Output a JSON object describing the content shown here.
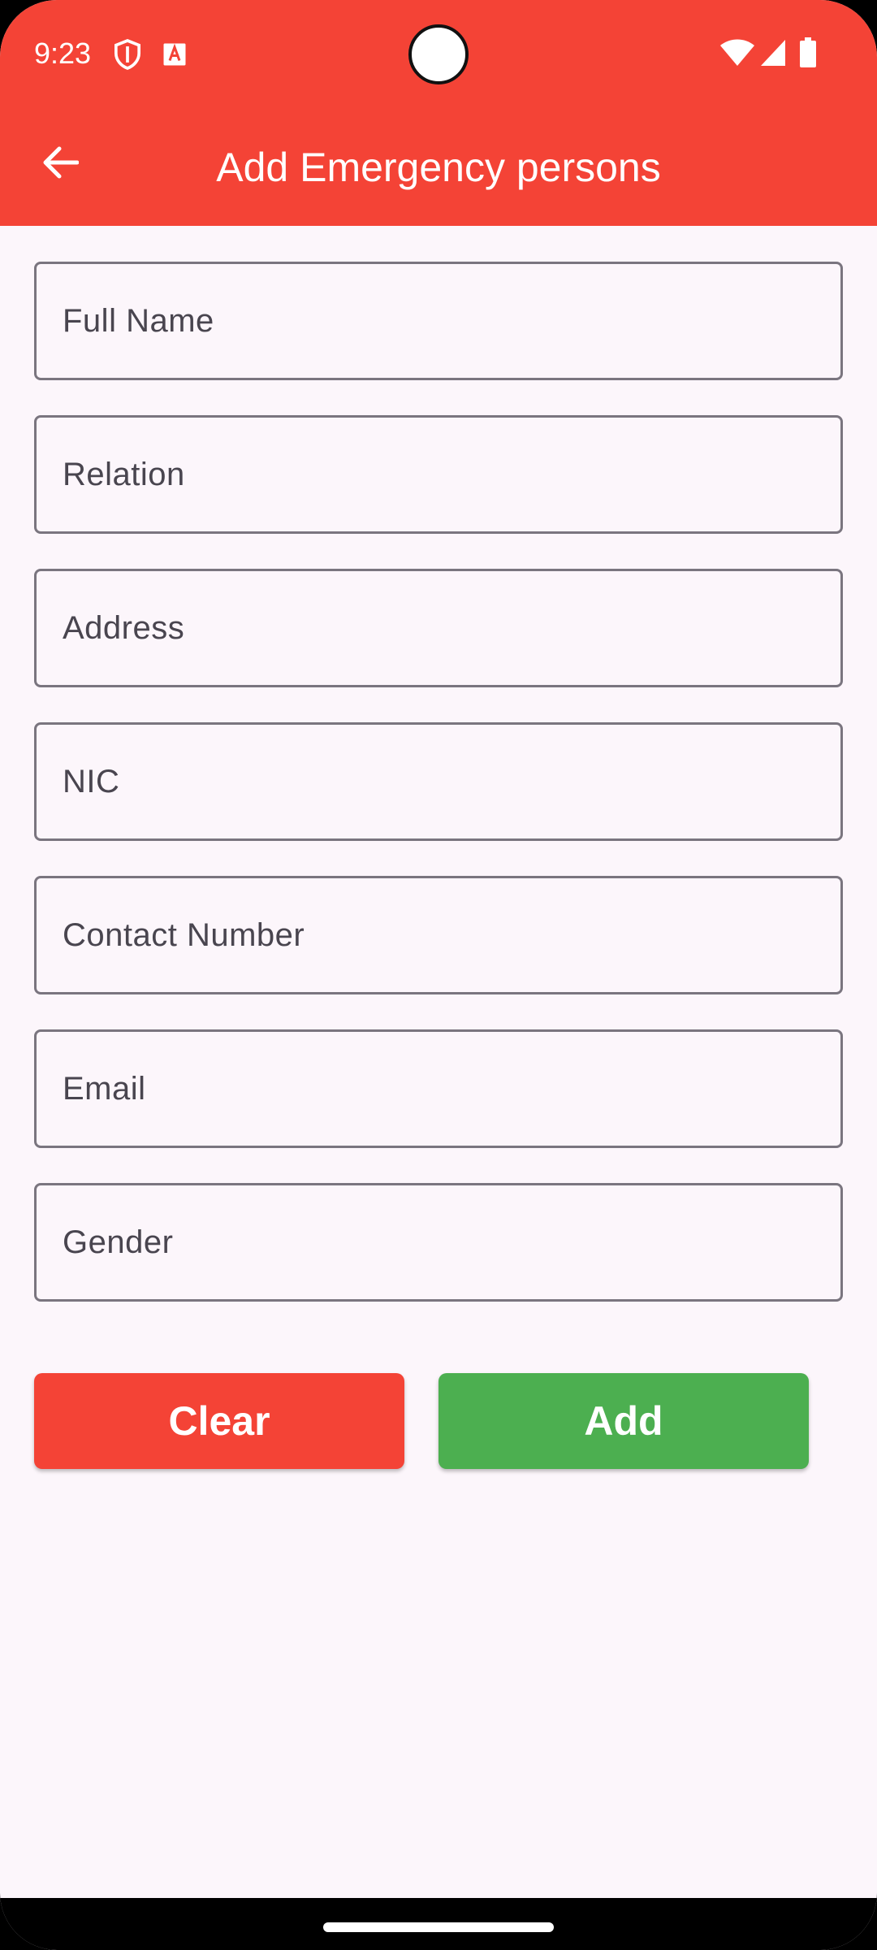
{
  "status_bar": {
    "time": "9:23",
    "left_icons": [
      "shield-icon",
      "font-icon"
    ],
    "right_icons": [
      "wifi-icon",
      "cellular-signal-icon",
      "battery-icon"
    ]
  },
  "app_bar": {
    "title": "Add Emergency persons",
    "back_icon": "arrow-back-icon",
    "color": "#f44336"
  },
  "form": {
    "fields": [
      {
        "placeholder": "Full Name",
        "value": ""
      },
      {
        "placeholder": "Relation",
        "value": ""
      },
      {
        "placeholder": "Address",
        "value": ""
      },
      {
        "placeholder": "NIC",
        "value": ""
      },
      {
        "placeholder": "Contact Number",
        "value": ""
      },
      {
        "placeholder": "Email",
        "value": ""
      },
      {
        "placeholder": "Gender",
        "value": ""
      }
    ]
  },
  "actions": {
    "clear_label": "Clear",
    "clear_color": "#f44336",
    "add_label": "Add",
    "add_color": "#4caf50"
  }
}
